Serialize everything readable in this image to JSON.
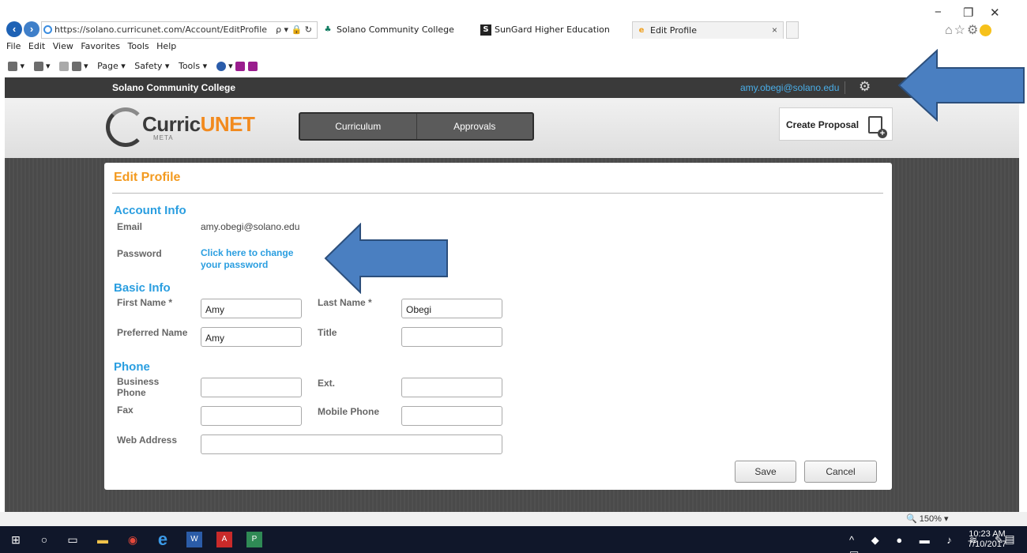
{
  "browser": {
    "address": "https://solano.curricunet.com/Account/EditProfile",
    "address_controls": "ρ ▾ 🔒 ↻",
    "tabs": [
      {
        "label": "Solano Community College",
        "icon": "leaf-icon"
      },
      {
        "label": "SunGard Higher Education",
        "icon": "s-icon"
      },
      {
        "label": "Edit Profile",
        "icon": "ie-icon"
      }
    ],
    "tab_close": "×",
    "window_controls": [
      "−",
      "❐",
      "✕"
    ],
    "menu": [
      "File",
      "Edit",
      "View",
      "Favorites",
      "Tools",
      "Help"
    ],
    "command_bar": [
      "Page ▾",
      "Safety ▾",
      "Tools ▾"
    ],
    "toolbar_icons": [
      "home-icon",
      "feed-icon",
      "mail-icon",
      "print-icon",
      "help-icon",
      "onenote-icon"
    ]
  },
  "site": {
    "college_name": "Solano Community College",
    "user_email": "amy.obegi@solano.edu",
    "logo_text_a": "Curric",
    "logo_text_b": "UNET",
    "logo_sub": "META",
    "nav": [
      "Curriculum",
      "Approvals"
    ],
    "create_proposal": "Create Proposal"
  },
  "form": {
    "title": "Edit Profile",
    "account_info": "Account Info",
    "email_label": "Email",
    "email_value": "amy.obegi@solano.edu",
    "password_label": "Password",
    "password_link": "Click here to change your password",
    "basic_info": "Basic Info",
    "first_name_label": "First Name *",
    "first_name_value": "Amy",
    "last_name_label": "Last Name *",
    "last_name_value": "Obegi",
    "preferred_name_label": "Preferred Name",
    "preferred_name_value": "Amy",
    "title_label": "Title",
    "title_value": "",
    "phone": "Phone",
    "business_phone_label": "Business Phone",
    "ext_label": "Ext.",
    "fax_label": "Fax",
    "mobile_phone_label": "Mobile Phone",
    "web_address_label": "Web Address",
    "save": "Save",
    "cancel": "Cancel"
  },
  "status": {
    "zoom": "150%",
    "time": "10:23 AM",
    "date": "7/10/2017"
  },
  "colors": {
    "accent_blue": "#2a9ee0",
    "accent_orange": "#f39a1f",
    "arrow_blue": "#4a7fc1"
  }
}
